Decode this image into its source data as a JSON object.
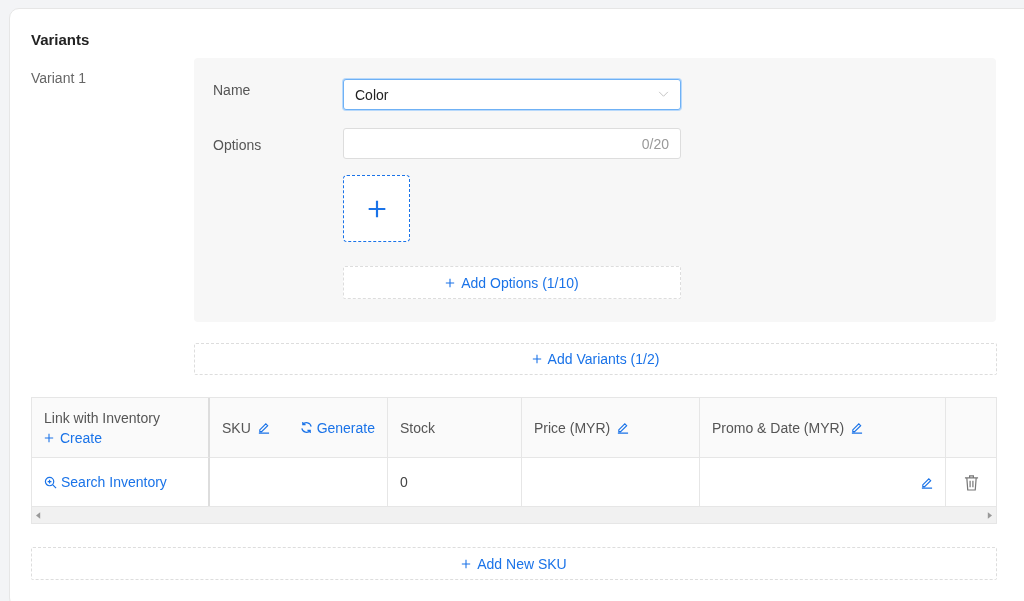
{
  "section_title": "Variants",
  "variants": [
    {
      "label": "Variant 1",
      "name_label": "Name",
      "name_value": "Color",
      "name_focused": true,
      "options_label": "Options",
      "options_counter": "0/20",
      "add_options": "Add Options (1/10)"
    }
  ],
  "add_variants": "Add Variants (1/2)",
  "table": {
    "columns": [
      {
        "kind": "link",
        "label": "Link with Inventory",
        "action": "Create"
      },
      {
        "kind": "sku",
        "label": "SKU",
        "editable": true,
        "action": "Generate"
      },
      {
        "kind": "plain",
        "label": "Stock",
        "editable": false
      },
      {
        "kind": "plain",
        "label": "Price (MYR)",
        "editable": true
      },
      {
        "kind": "plain",
        "label": "Promo & Date (MYR)",
        "editable": true
      },
      {
        "kind": "actions"
      }
    ],
    "rows": [
      {
        "link": "Search Inventory",
        "sku": "",
        "stock": "0",
        "price": "",
        "promo": ""
      }
    ]
  },
  "add_sku": "Add New SKU"
}
